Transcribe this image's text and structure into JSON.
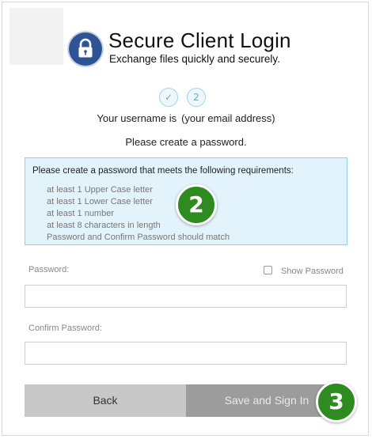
{
  "header": {
    "title": "Secure Client Login",
    "subtitle": "Exchange files quickly and securely.",
    "logo_icon": "lock-icon",
    "accent_color": "#2f5496"
  },
  "steps": [
    {
      "label": "✓",
      "state": "complete"
    },
    {
      "label": "2",
      "state": "current"
    }
  ],
  "username_line": {
    "prefix": "Your username is",
    "value": "(your email address)"
  },
  "instruction": "Please create a password.",
  "requirements": {
    "header": "Please create a password that meets the following requirements:",
    "items": [
      "at least 1 Upper Case letter",
      "at least 1 Lower Case letter",
      "at least 1 number",
      "at least 8 characters in length",
      "Password and Confirm Password should match"
    ]
  },
  "form": {
    "password_label": "Password:",
    "password_value": "",
    "show_password_label": "Show Password",
    "show_password_checked": false,
    "confirm_label": "Confirm Password:",
    "confirm_value": ""
  },
  "buttons": {
    "back": "Back",
    "save": "Save and Sign In"
  },
  "badges": {
    "badge_a": "2",
    "badge_b": "3",
    "color": "#2e8b1f"
  }
}
